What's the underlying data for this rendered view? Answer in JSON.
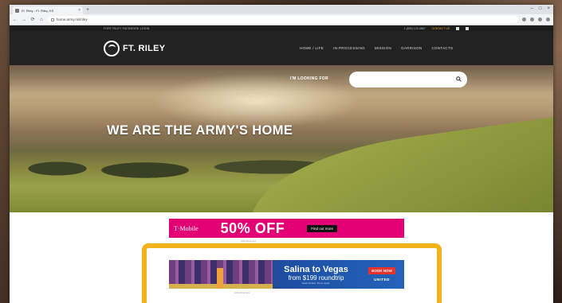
{
  "browser": {
    "tab_title": "Ft. Riley - Ft. Riley, KS",
    "tab_close": "×",
    "new_tab": "+",
    "url": "home.army.mil/riley",
    "window_controls": [
      "–",
      "□",
      "×"
    ],
    "nav_back": "←",
    "nav_forward": "→",
    "nav_reload": "⟳",
    "nav_home": "⌂"
  },
  "utility_bar": {
    "left_text": "FORT RILEY FACEBOOK LOGIN",
    "phone": "1 (800) 123-4567",
    "accent_link": "CONTACT US"
  },
  "site": {
    "logo_text": "FT. RILEY",
    "menu": [
      "HOME / LIFE",
      "IN-PROCESSING",
      "MISSION",
      "GARRISON",
      "CONTACTS"
    ]
  },
  "hero": {
    "search_label": "I'M LOOKING FOR",
    "search_value": "",
    "title": "WE ARE THE ARMY'S HOME"
  },
  "ads": {
    "tmobile": {
      "brand": "T·Mobile",
      "offer": "50% OFF",
      "cta": "Find out more"
    },
    "caption_top": "Advertisement",
    "united": {
      "headline": "Salina to Vegas",
      "subhead": "from $199 roundtrip",
      "fine_print": "Seats limited. Terms apply.",
      "cta": "BOOK NOW",
      "brand": "UNITED"
    },
    "caption_bottom": "Advertisement"
  },
  "colors": {
    "highlight": "#f3b21a",
    "tmobile": "#e20074",
    "nav_bg": "#222222"
  }
}
